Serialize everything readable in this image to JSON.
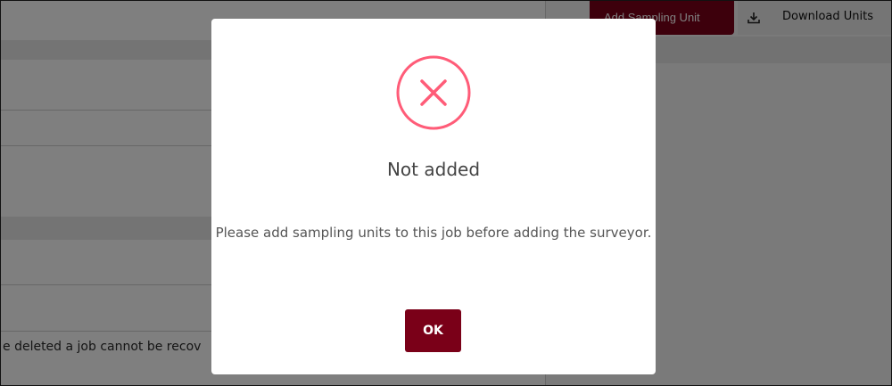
{
  "background": {
    "footer_warning": "e deleted a job cannot be recov",
    "toolbar": {
      "add_sampling_unit_label": "Add Sampling Unit",
      "download_units_label": "Download Units",
      "download_icon": "download-icon"
    }
  },
  "modal": {
    "icon": "error-x-icon",
    "title": "Not added",
    "message": "Please add sampling units to this job before adding the surveyor.",
    "ok_label": "OK"
  },
  "colors": {
    "accent": "#7a0018",
    "error_icon": "#ff5c78",
    "overlay": "rgba(0,0,0,0.5)"
  }
}
